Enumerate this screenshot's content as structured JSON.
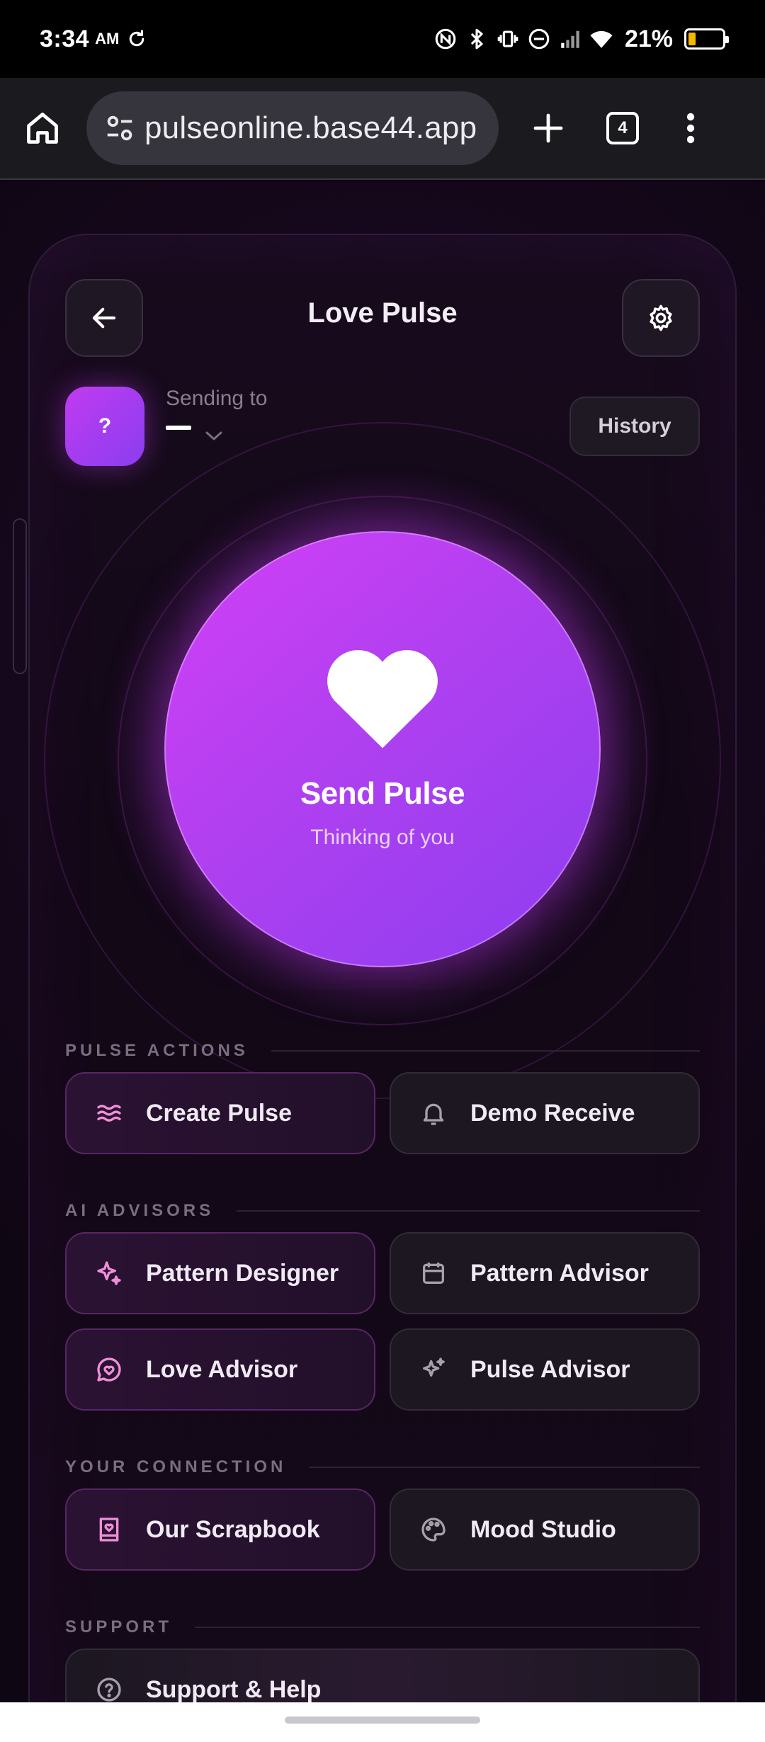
{
  "status_bar": {
    "time": "3:34",
    "ampm": "AM",
    "battery_percent": "21%",
    "battery_level": 0.21,
    "icons": [
      "sync-icon",
      "nfc-icon",
      "bluetooth-icon",
      "vibrate-icon",
      "dnd-icon",
      "signal-icon",
      "wifi-icon",
      "battery-icon"
    ]
  },
  "browser": {
    "url": "pulseonline.base44.app",
    "tab_count": "4"
  },
  "header": {
    "title": "Love Pulse"
  },
  "recipient": {
    "avatar_text": "?",
    "sending_label": "Sending to",
    "history_label": "History"
  },
  "pulse": {
    "title": "Send Pulse",
    "subtitle": "Thinking of you"
  },
  "sections": {
    "pulse_actions": "PULSE ACTIONS",
    "ai_advisors": "AI ADVISORS",
    "your_connection": "YOUR CONNECTION",
    "support": "SUPPORT"
  },
  "actions": {
    "create_pulse": "Create Pulse",
    "demo_receive": "Demo Receive",
    "pattern_designer": "Pattern Designer",
    "pattern_advisor": "Pattern Advisor",
    "love_advisor": "Love Advisor",
    "pulse_advisor": "Pulse Advisor",
    "our_scrapbook": "Our Scrapbook",
    "mood_studio": "Mood Studio",
    "support_help": "Support & Help"
  },
  "colors": {
    "accent": "#c13cf0",
    "accent_2": "#8a3df0",
    "pink_icon": "#f08fd8",
    "background": "#120816"
  }
}
